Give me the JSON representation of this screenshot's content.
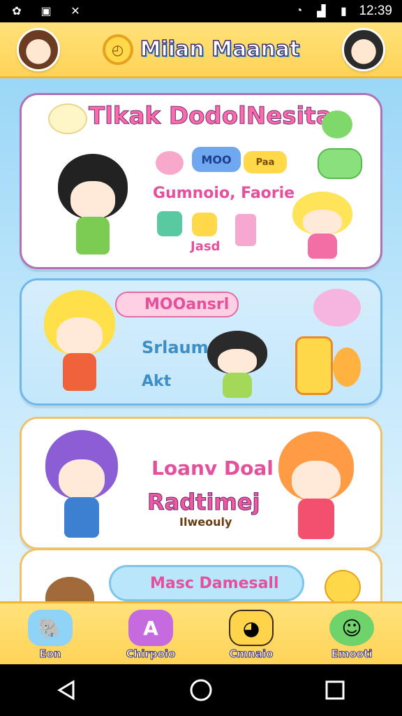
{
  "status_bar": {
    "time": "12:39"
  },
  "header": {
    "title": "Miian Maanat"
  },
  "cards": [
    {
      "headline": "Tlkak DodolNesita",
      "subtitle": "Gumnoio, Faorie",
      "stickers": [
        "MOO",
        "Paa"
      ],
      "caption": "Jasd"
    },
    {
      "pill_label": "MOOansrl",
      "line1": "Srlaum",
      "line2": "Akt"
    },
    {
      "line1": "Loanv Doal",
      "line2": "Radtimej",
      "line3": "Ilweouly"
    },
    {
      "banner": "Masc Damesall"
    }
  ],
  "bottom_nav": [
    {
      "label": "Eon",
      "icon": "elephant-icon",
      "color": "#8fd3f6"
    },
    {
      "label": "Chirpoio",
      "icon": "letter-a-icon",
      "color": "#c66ae0"
    },
    {
      "label": "Cmnaio",
      "icon": "cheese-icon",
      "color": "#ffd44a"
    },
    {
      "label": "Emooti",
      "icon": "chat-bubble-icon",
      "color": "#6fd36b"
    }
  ]
}
